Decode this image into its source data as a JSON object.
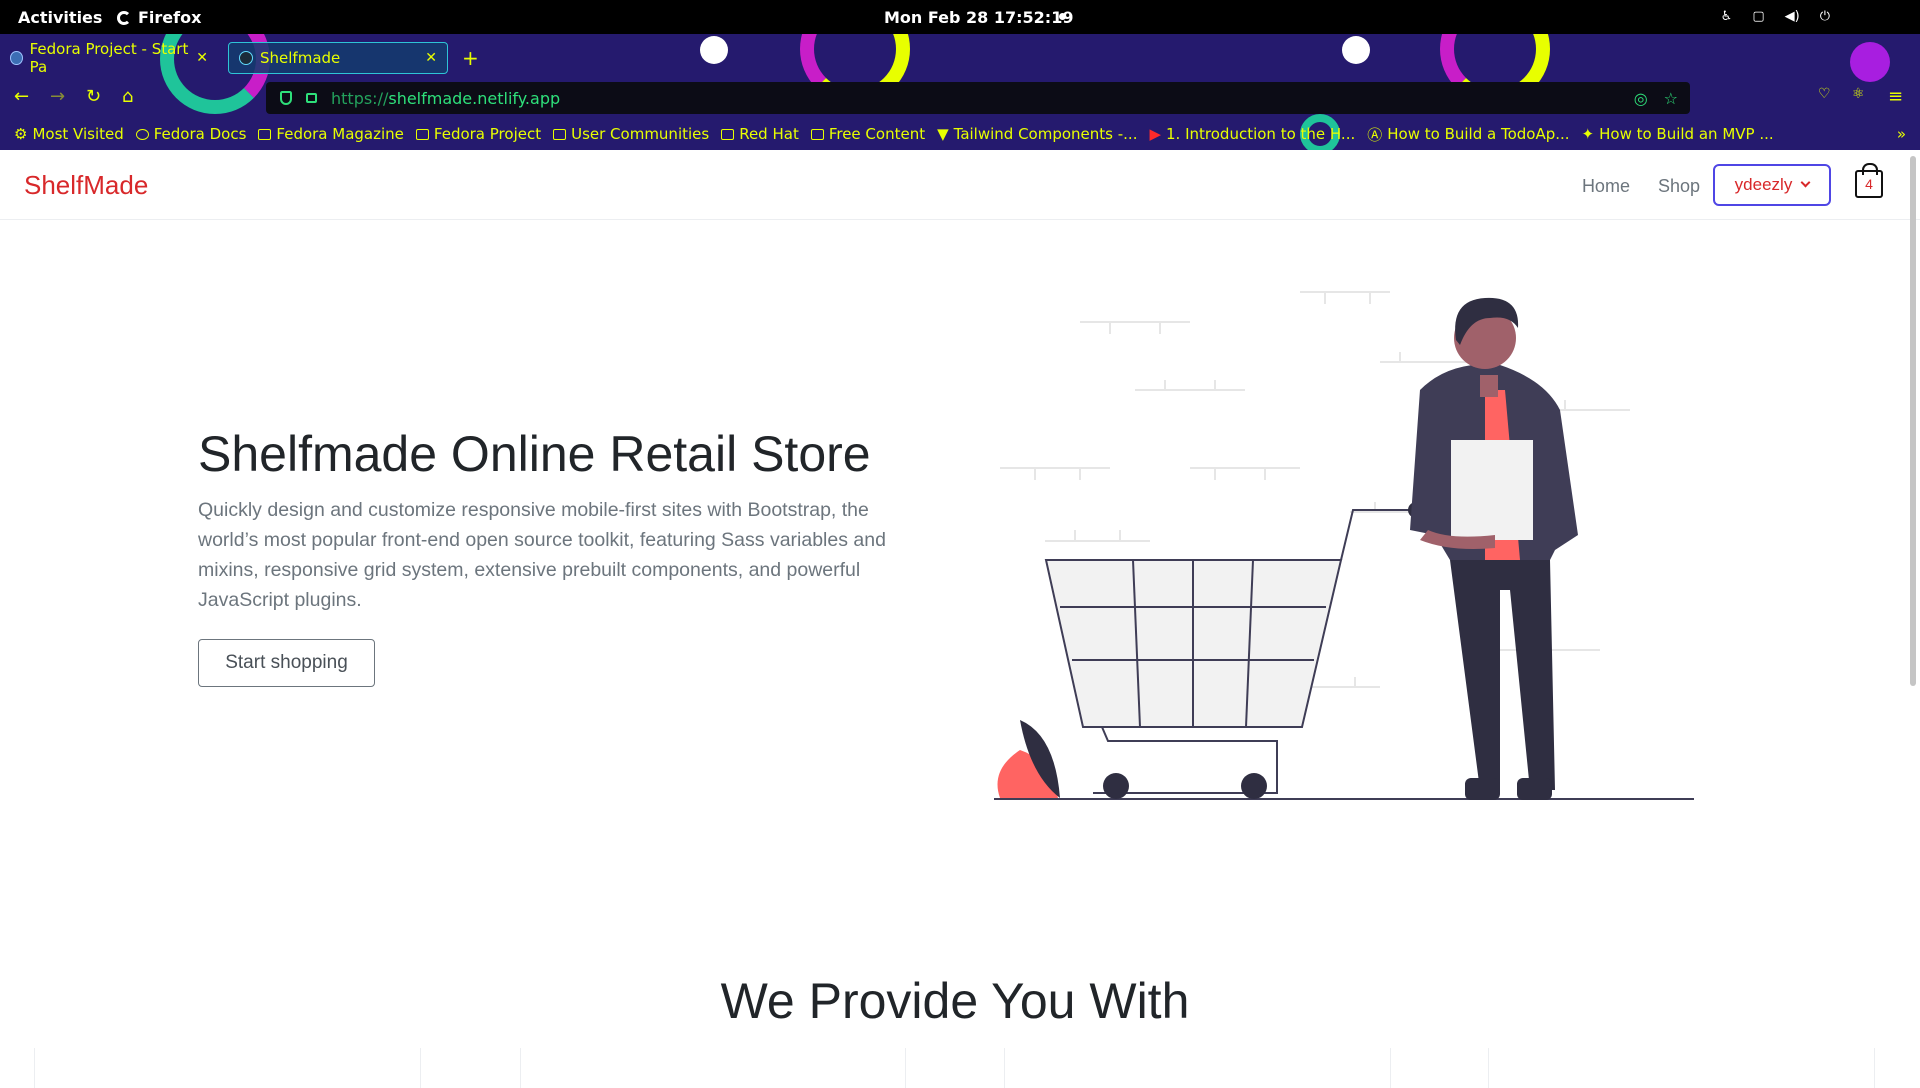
{
  "system_bar": {
    "activities": "Activities",
    "app_name": "Firefox",
    "clock": "Mon Feb 28  17:52:19"
  },
  "browser": {
    "tabs": [
      {
        "label": "Fedora Project - Start Pa",
        "active": false
      },
      {
        "label": "Shelfmade",
        "active": true
      }
    ],
    "new_tab": "+",
    "url_protocol": "https://",
    "url_host": "shelfmade.netlify.app",
    "bookmarks": [
      {
        "label": "Most Visited",
        "icon": "gear-icon"
      },
      {
        "label": "Fedora Docs",
        "icon": "fedora-icon"
      },
      {
        "label": "Fedora Magazine",
        "icon": "fm-icon"
      },
      {
        "label": "Fedora Project",
        "icon": "folder-icon"
      },
      {
        "label": "User Communities",
        "icon": "folder-icon"
      },
      {
        "label": "Red Hat",
        "icon": "folder-icon"
      },
      {
        "label": "Free Content",
        "icon": "folder-icon"
      },
      {
        "label": "Tailwind Components -...",
        "icon": "tailwind-icon"
      },
      {
        "label": "1. Introduction to the H...",
        "icon": "youtube-icon"
      },
      {
        "label": "How to Build a TodoAp...",
        "icon": "angular-icon"
      },
      {
        "label": "How to Build an MVP ...",
        "icon": "link-icon"
      }
    ],
    "theme_colors": {
      "bg": "#251a6e",
      "accent": "#e8ff00",
      "url_text": "#2ee07a"
    }
  },
  "site": {
    "brand": "ShelfMade",
    "nav": {
      "home": "Home",
      "shop": "Shop"
    },
    "user": "ydeezly",
    "cart_count": "4",
    "hero": {
      "title": "Shelfmade Online Retail Store",
      "text": "Quickly design and customize responsive mobile-first sites with Bootstrap, the world’s most popular front-end open source toolkit, featuring Sass variables and mixins, responsive grid system, extensive prebuilt components, and powerful JavaScript plugins.",
      "cta": "Start shopping"
    },
    "section_title": "We Provide You With",
    "colors": {
      "brand": "#d8282a",
      "user_border": "#4f46e5",
      "illus_dark": "#2f2e41",
      "illus_accent": "#ff6462"
    }
  }
}
